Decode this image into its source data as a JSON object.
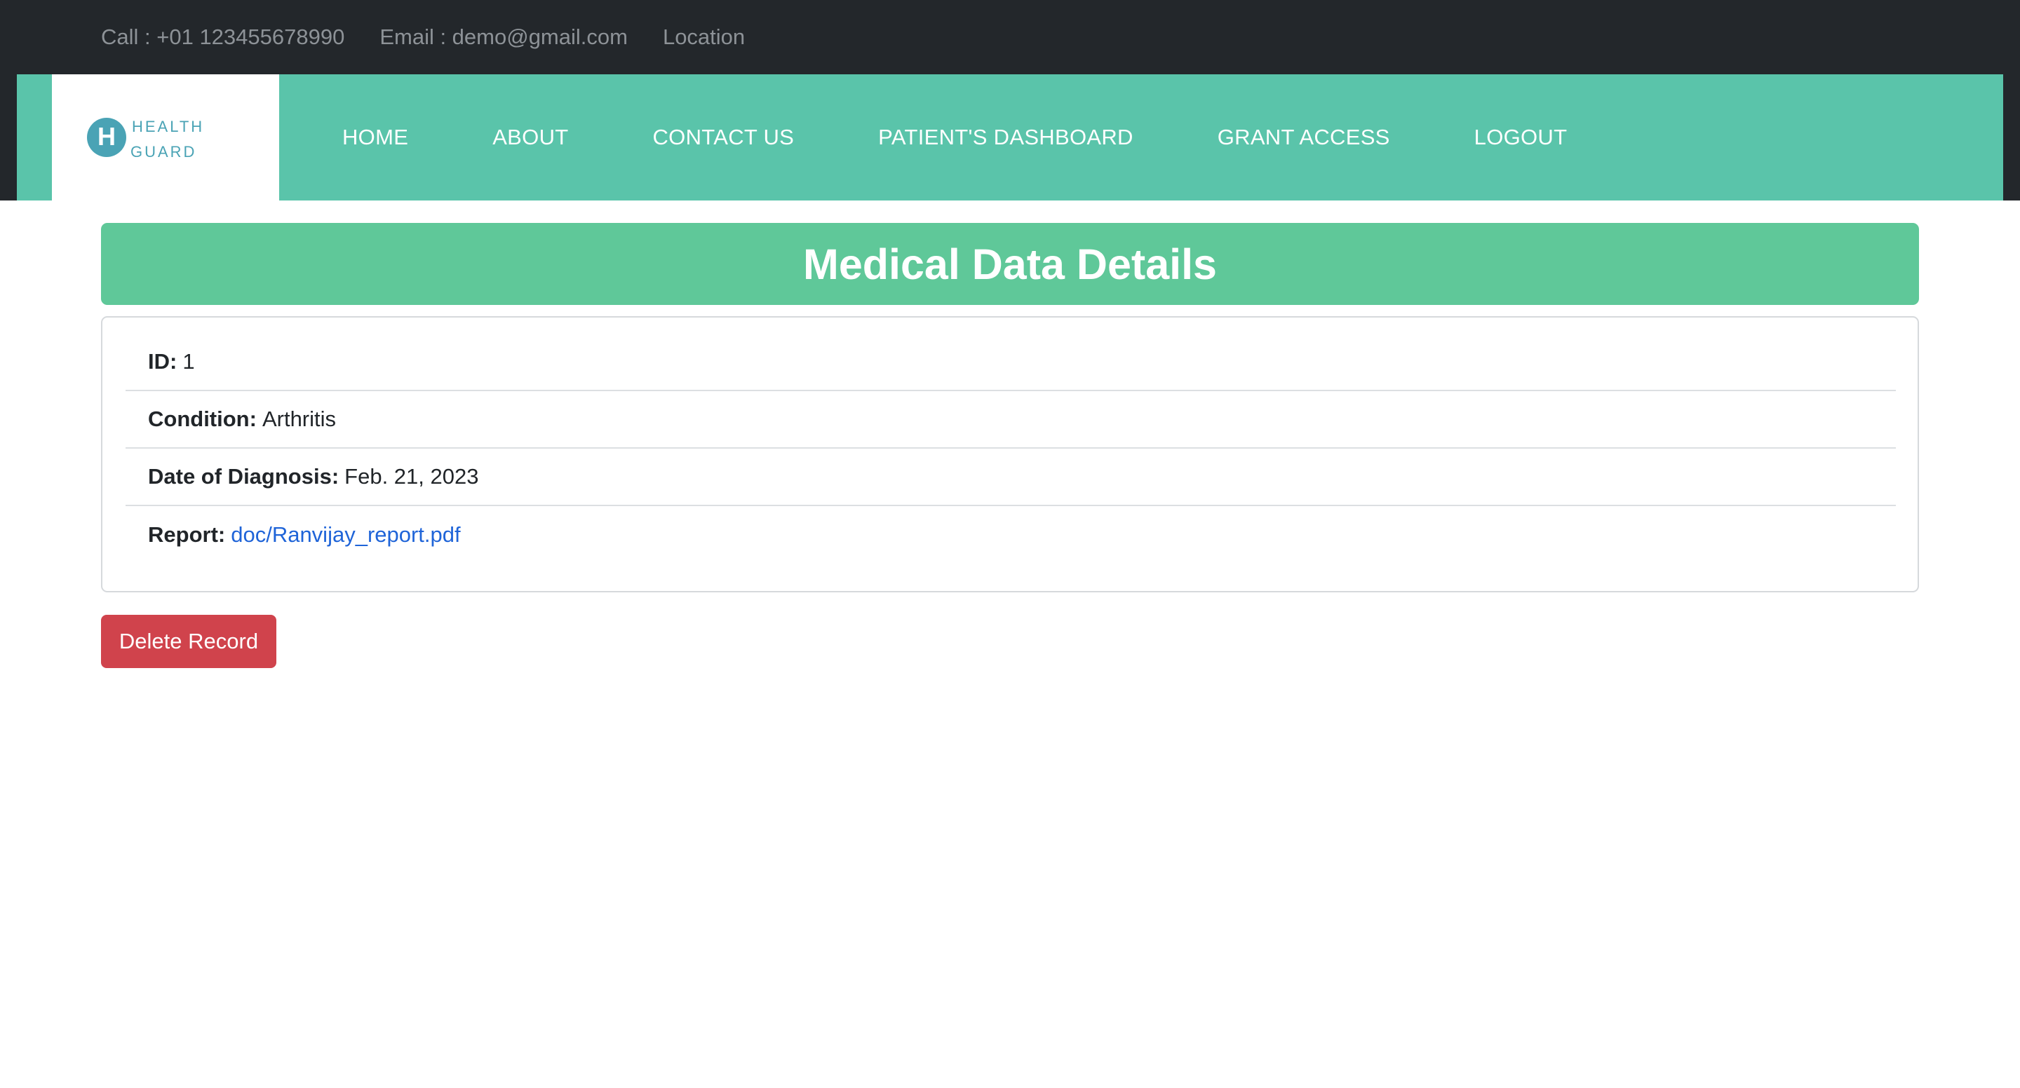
{
  "topbar": {
    "call": "Call : +01 123455678990",
    "email": "Email : demo@gmail.com",
    "location": "Location"
  },
  "brand": {
    "initial": "H",
    "line1": "HEALTH",
    "line2": "GUARD"
  },
  "nav": {
    "items": [
      "HOME",
      "ABOUT",
      "CONTACT US",
      "PATIENT'S DASHBOARD",
      "GRANT ACCESS",
      "LOGOUT"
    ]
  },
  "page": {
    "title": "Medical Data Details"
  },
  "record": {
    "id_label": "ID:",
    "id_value": "1",
    "condition_label": "Condition:",
    "condition_value": "Arthritis",
    "date_label": "Date of Diagnosis:",
    "date_value": "Feb. 21, 2023",
    "report_label": "Report:",
    "report_value": "doc/Ranvijay_report.pdf"
  },
  "actions": {
    "delete_label": "Delete Record"
  },
  "colors": {
    "topbar": "#23272b",
    "navbar": "#5ac4aa",
    "header": "#5fc899",
    "logo": "#4aa3b5",
    "danger": "#d0434c",
    "link": "#1f64d8"
  }
}
